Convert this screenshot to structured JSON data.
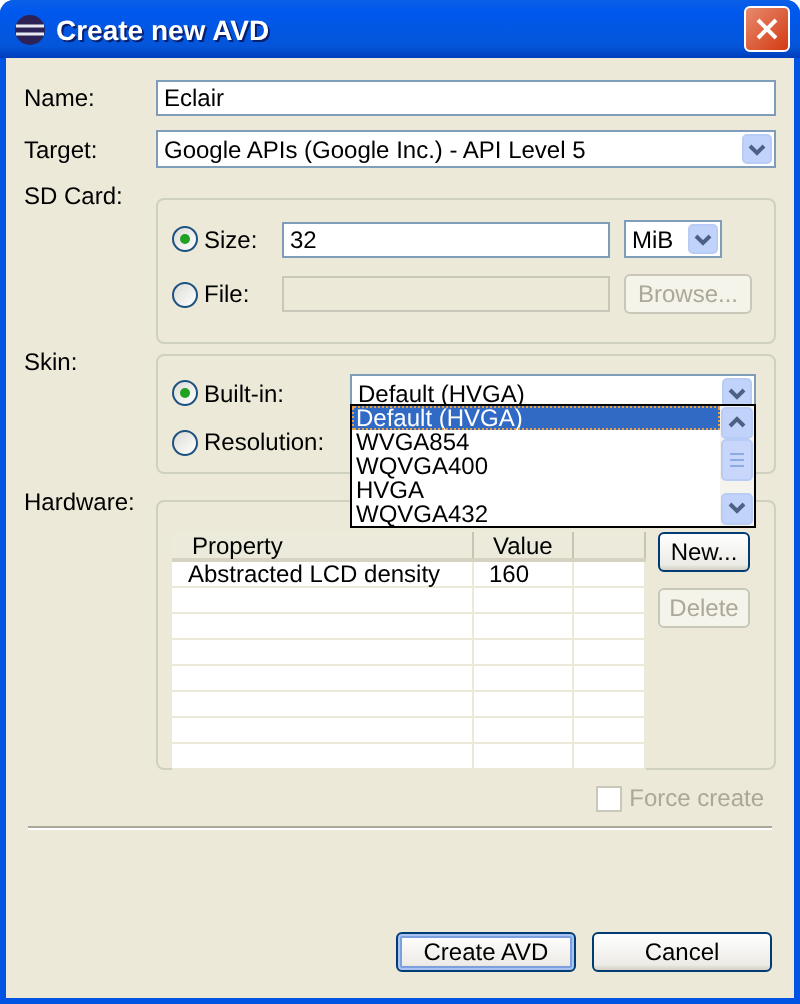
{
  "window": {
    "title": "Create new AVD"
  },
  "name": {
    "label": "Name:",
    "value": "Eclair"
  },
  "target": {
    "label": "Target:",
    "value": "Google APIs (Google Inc.) - API Level 5"
  },
  "sd_card": {
    "label": "SD Card:",
    "options": [
      {
        "kind": "size",
        "label": "Size:",
        "selected": true,
        "value": "32",
        "unit": "MiB"
      },
      {
        "kind": "file",
        "label": "File:",
        "selected": false,
        "button": "Browse...",
        "disabled": true
      }
    ]
  },
  "skin": {
    "label": "Skin:",
    "options": [
      {
        "kind": "builtin",
        "label": "Built-in:",
        "selected": true,
        "value": "Default (HVGA)"
      },
      {
        "kind": "resolution",
        "label": "Resolution:",
        "selected": false
      }
    ],
    "dropdown_list": [
      {
        "label": "Default (HVGA)",
        "selected": true
      },
      {
        "label": "WVGA854",
        "selected": false
      },
      {
        "label": "WQVGA400",
        "selected": false
      },
      {
        "label": "HVGA",
        "selected": false
      },
      {
        "label": "WQVGA432",
        "selected": false
      }
    ]
  },
  "hardware": {
    "label": "Hardware:",
    "columns": [
      "Property",
      "Value"
    ],
    "rows": [
      [
        "Abstracted LCD density",
        "160"
      ]
    ],
    "buttons": [
      {
        "label": "New...",
        "disabled": false
      },
      {
        "label": "Delete",
        "disabled": true
      }
    ]
  },
  "force_create": {
    "label": "Force create",
    "checked": false,
    "disabled": true
  },
  "buttons": [
    {
      "label": "Create AVD",
      "default": true
    },
    {
      "label": "Cancel",
      "default": false
    }
  ]
}
